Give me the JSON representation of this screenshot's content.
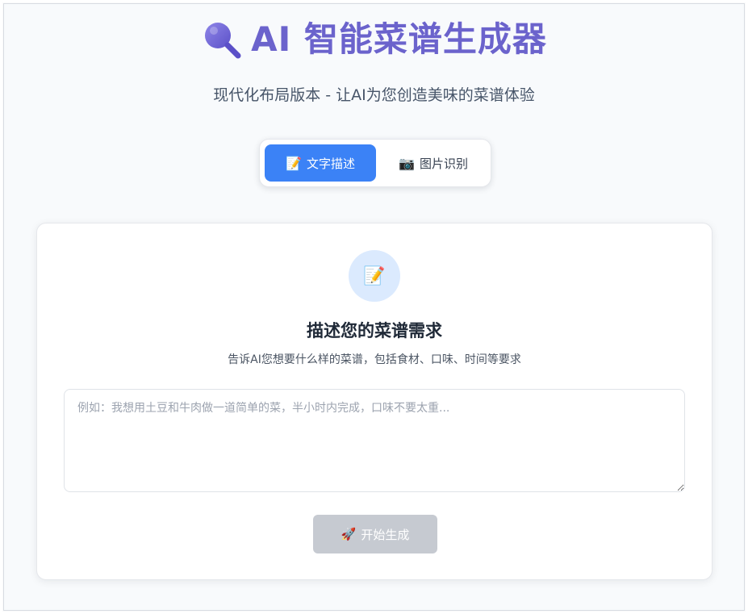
{
  "header": {
    "title": "AI 智能菜谱生成器",
    "title_icon": "magnifier-icon",
    "subtitle": "现代化布局版本 - 让AI为您创造美味的菜谱体验"
  },
  "tabs": [
    {
      "icon": "📝",
      "icon_name": "memo-icon",
      "label": "文字描述",
      "active": true
    },
    {
      "icon": "📷",
      "icon_name": "camera-icon",
      "label": "图片识别",
      "active": false
    }
  ],
  "card": {
    "icon": "📝",
    "icon_name": "memo-icon",
    "title": "描述您的菜谱需求",
    "description": "告诉AI您想要什么样的菜谱，包括食材、口味、时间等要求",
    "input": {
      "value": "",
      "placeholder": "例如：我想用土豆和牛肉做一道简单的菜，半小时内完成，口味不要太重..."
    },
    "generate_button": {
      "icon": "🚀",
      "icon_name": "rocket-icon",
      "label": "开始生成",
      "disabled": true
    }
  },
  "colors": {
    "title": "#6b63cc",
    "tab_active": "#3b82f6",
    "icon_circle": "#dbeafe",
    "button_disabled": "#c6cad1"
  }
}
